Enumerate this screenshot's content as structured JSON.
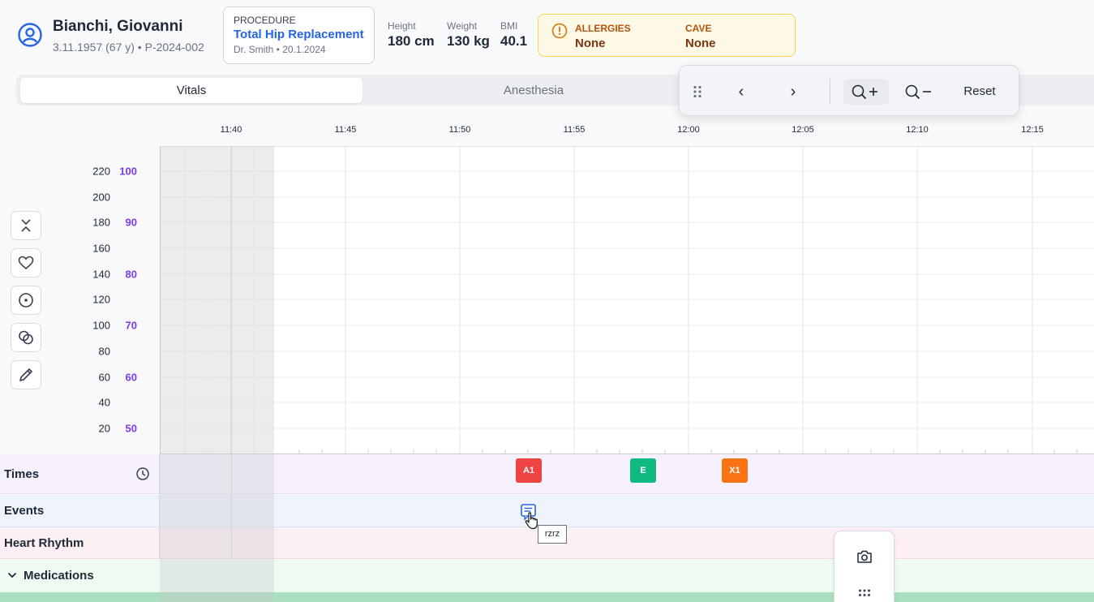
{
  "patient": {
    "name": "Bianchi, Giovanni",
    "meta": "3.11.1957 (67 y) • P-2024-002"
  },
  "procedure": {
    "label": "PROCEDURE",
    "name": "Total Hip Replacement",
    "meta": "Dr. Smith • 20.1.2024"
  },
  "measurements": [
    {
      "label": "Height",
      "value": "180 cm"
    },
    {
      "label": "Weight",
      "value": "130 kg"
    },
    {
      "label": "BMI",
      "value": "40.1"
    }
  ],
  "alerts": {
    "allergies_label": "ALLERGIES",
    "allergies_value": "None",
    "cave_label": "CAVE",
    "cave_value": "None"
  },
  "tabs": [
    {
      "label": "Vitals",
      "active": true
    },
    {
      "label": "Anesthesia",
      "active": false
    }
  ],
  "toolbar": {
    "prev": "‹",
    "next": "›",
    "reset": "Reset"
  },
  "time_axis": [
    "11:40",
    "11:45",
    "11:50",
    "11:55",
    "12:00",
    "12:05",
    "12:10",
    "12:15"
  ],
  "y_axis_primary": [
    "220",
    "200",
    "180",
    "160",
    "140",
    "120",
    "100",
    "80",
    "60",
    "40",
    "20"
  ],
  "y_axis_secondary": [
    "100",
    "90",
    "80",
    "70",
    "60",
    "50"
  ],
  "rows": {
    "times": "Times",
    "events": "Events",
    "heart_rhythm": "Heart Rhythm",
    "medications": "Medications"
  },
  "time_markers": [
    {
      "label": "A1",
      "color": "#ef4444"
    },
    {
      "label": "E",
      "color": "#10b981"
    },
    {
      "label": "X1",
      "color": "#f97316"
    }
  ],
  "event_tooltip": "rzrz",
  "icons": [
    "user-circle-icon",
    "alert-circle-icon",
    "drag-handle-icon",
    "zoom-in-icon",
    "zoom-out-icon",
    "collapse-icon",
    "heart-icon",
    "target-icon",
    "circles-icon",
    "pencil-icon",
    "clock-icon",
    "note-icon",
    "cursor-hand-icon",
    "chevron-down-icon",
    "camera-icon",
    "grid-dots-icon"
  ]
}
